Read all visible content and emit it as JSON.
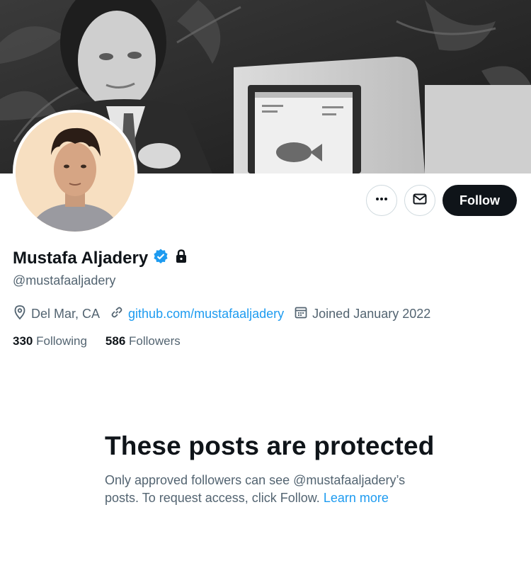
{
  "profile": {
    "display_name": "Mustafa Aljadery",
    "handle": "@mustafaaljadery",
    "verified_icon": "verified-badge-icon",
    "lock_icon": "lock-icon",
    "location": "Del Mar, CA",
    "website": "github.com/mustafaaljadery",
    "joined": "Joined January 2022",
    "following_count": "330",
    "following_label": "Following",
    "followers_count": "586",
    "followers_label": "Followers"
  },
  "actions": {
    "more_icon": "more-icon",
    "message_icon": "envelope-icon",
    "follow_label": "Follow"
  },
  "protected": {
    "title": "These posts are protected",
    "description_prefix": "Only approved followers can see @mustafaaljadery’s posts. To request access, click Follow.",
    "learn_more": "Learn more"
  },
  "colors": {
    "accent": "#1d9bf0",
    "text_primary": "#0f1419",
    "text_secondary": "#536471",
    "button_dark": "#0f1419"
  }
}
